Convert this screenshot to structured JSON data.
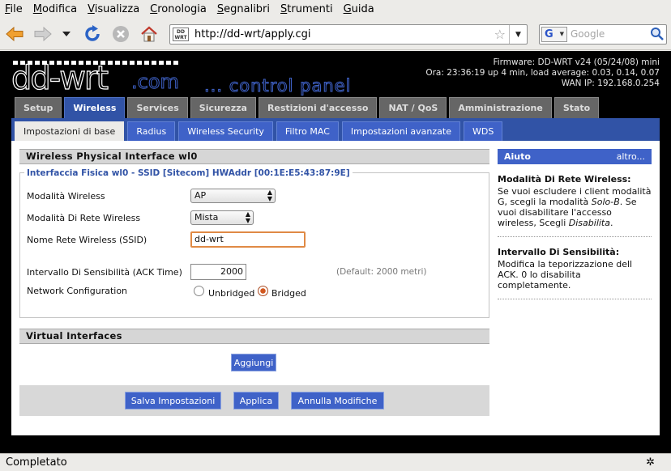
{
  "browser": {
    "menu": [
      {
        "u": "F",
        "rest": "ile"
      },
      {
        "u": "M",
        "rest": "odifica"
      },
      {
        "u": "V",
        "rest": "isualizza"
      },
      {
        "u": "C",
        "rest": "ronologia"
      },
      {
        "u": "S",
        "rest": "egnalibri"
      },
      {
        "u": "S",
        "rest": "trumenti"
      },
      {
        "u": "G",
        "rest": "uida"
      }
    ],
    "url": "http://dd-wrt/apply.cgi",
    "favicon_text": "DD WRT",
    "search_engine": "G",
    "search_placeholder": "Google",
    "status": "Completato"
  },
  "header": {
    "logo_main": "dd-wrt",
    "logo_com": ".com",
    "logo_cp": "... control panel",
    "firmware": "Firmware: DD-WRT v24 (05/24/08) mini",
    "time": "Ora: 23:36:19 up 4 min, load average: 0.03, 0.14, 0.07",
    "wan_ip": "WAN IP: 192.168.0.254"
  },
  "main_tabs": [
    "Setup",
    "Wireless",
    "Services",
    "Sicurezza",
    "Restizioni d'accesso",
    "NAT / QoS",
    "Amministrazione",
    "Stato"
  ],
  "main_tab_active": "Wireless",
  "sub_tabs": [
    "Impostazioni di base",
    "Radius",
    "Wireless Security",
    "Filtro MAC",
    "Impostazioni avanzate",
    "WDS"
  ],
  "sub_tab_active": "Impostazioni di base",
  "physical": {
    "section_title": "Wireless Physical Interface wl0",
    "legend": "Interfaccia Fisica wl0 - SSID [Sitecom] HWAddr [00:1E:E5:43:87:9E]",
    "wireless_mode_label": "Modalità Wireless",
    "wireless_mode_value": "AP",
    "network_mode_label": "Modalità Di Rete Wireless",
    "network_mode_value": "Mista",
    "ssid_label": "Nome Rete Wireless (SSID)",
    "ssid_value": "dd-wrt",
    "ack_label": "Intervallo Di Sensibilità (ACK Time)",
    "ack_value": "2000",
    "ack_default": "(Default: 2000 metri)",
    "netconf_label": "Network Configuration",
    "unbridged_label": "Unbridged",
    "bridged_label": "Bridged",
    "selected_config": "Bridged"
  },
  "virtual": {
    "section_title": "Virtual Interfaces",
    "add_label": "Aggiungi"
  },
  "buttons": {
    "save": "Salva Impostazioni",
    "apply": "Applica",
    "cancel": "Annulla Modifiche"
  },
  "help": {
    "title": "Aiuto",
    "more": "altro...",
    "items": [
      {
        "title": "Modalità Di Rete Wireless:",
        "body_pre": "Se vuoi escludere i client modalità G, scegli la modalità ",
        "body_em1": "Solo-B",
        "body_mid": ". Se vuoi disabilitare l'accesso wireless, Scegli ",
        "body_em2": "Disabilita",
        "body_post": "."
      },
      {
        "title": "Intervallo Di Sensibilità:",
        "body": "Modifica la teporizzazione dell ACK. 0 lo disabilita completamente."
      }
    ]
  },
  "colors": {
    "tab_active": "#3153a6",
    "sub_tab_bg": "#3f62c8",
    "button_blue": "#3f62c8",
    "legend_blue": "#3153a6",
    "radio_selected": "#d2571e",
    "focus_border": "#e08a45"
  }
}
